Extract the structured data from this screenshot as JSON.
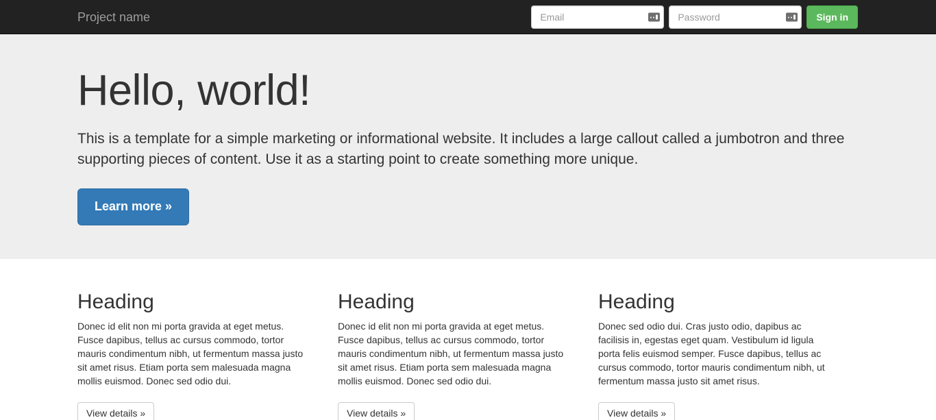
{
  "navbar": {
    "brand": "Project name",
    "email_placeholder": "Email",
    "password_placeholder": "Password",
    "email_value": "",
    "password_value": "",
    "signin_label": "Sign in",
    "icons": {
      "email_autofill": "autofill-icon",
      "password_autofill": "autofill-icon"
    },
    "colors": {
      "background": "#222222",
      "brand_text": "#9d9d9d",
      "signin_bg": "#5cb85c",
      "signin_border": "#4cae4c"
    }
  },
  "jumbotron": {
    "heading": "Hello, world!",
    "lead": "This is a template for a simple marketing or informational website. It includes a large callout called a jumbotron and three supporting pieces of content. Use it as a starting point to create something more unique.",
    "cta_label": "Learn more »",
    "colors": {
      "background": "#eeeeee",
      "cta_bg": "#337ab7",
      "cta_border": "#2e6da4"
    }
  },
  "columns": [
    {
      "heading": "Heading",
      "body": "Donec id elit non mi porta gravida at eget metus. Fusce dapibus, tellus ac cursus commodo, tortor mauris condimentum nibh, ut fermentum massa justo sit amet risus. Etiam porta sem malesuada magna mollis euismod. Donec sed odio dui.",
      "button_label": "View details »"
    },
    {
      "heading": "Heading",
      "body": "Donec id elit non mi porta gravida at eget metus. Fusce dapibus, tellus ac cursus commodo, tortor mauris condimentum nibh, ut fermentum massa justo sit amet risus. Etiam porta sem malesuada magna mollis euismod. Donec sed odio dui.",
      "button_label": "View details »"
    },
    {
      "heading": "Heading",
      "body": "Donec sed odio dui. Cras justo odio, dapibus ac facilisis in, egestas eget quam. Vestibulum id ligula porta felis euismod semper. Fusce dapibus, tellus ac cursus commodo, tortor mauris condimentum nibh, ut fermentum massa justo sit amet risus.",
      "button_label": "View details »"
    }
  ]
}
